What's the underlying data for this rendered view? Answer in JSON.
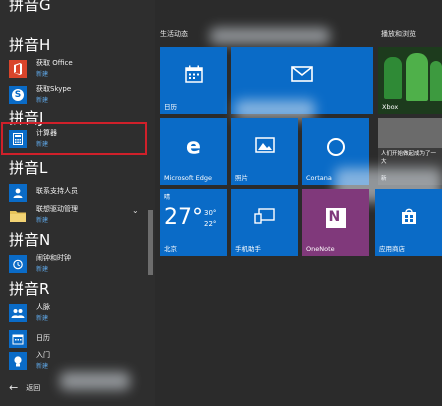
{
  "letters": {
    "h": "拼音H",
    "j": "拼音J",
    "l": "拼音L",
    "n": "拼音N",
    "r": "拼音R",
    "top_partial": "拼音G"
  },
  "apps": [
    {
      "name": "获取 Office",
      "sub": "新建"
    },
    {
      "name": "获取Skype",
      "sub": "新建"
    },
    {
      "name": "计算器",
      "sub": "新建"
    },
    {
      "name": "联系支持人员",
      "sub": ""
    },
    {
      "name": "联想驱动管理",
      "sub": "新建"
    },
    {
      "name": "闹钟和时钟",
      "sub": "新建"
    },
    {
      "name": "人脉",
      "sub": "新建"
    },
    {
      "name": "日历",
      "sub": ""
    },
    {
      "name": "入门",
      "sub": "新建"
    }
  ],
  "back_label": "返回",
  "groups": {
    "life": "生活动态",
    "play": "播放和浏览"
  },
  "tiles": {
    "calendar": "日历",
    "mail": "",
    "edge": "Microsoft Edge",
    "photos": "照片",
    "cortana": "Cortana",
    "weather_label": "北京",
    "weather_condition": "晴",
    "weather_temp": "27°",
    "weather_high": "30°",
    "weather_low": "22°",
    "phone": "手机助手",
    "onenote": "OneNote",
    "store": "应用商店",
    "xbox": "Xbox",
    "news": "人们开始做起成为了一大",
    "news_more": "新"
  },
  "colors": {
    "tile_blue": "#0a6bc7",
    "onenote_purple": "#80397b",
    "selection_red": "#d0202a",
    "subtext_blue": "#5fa8e8"
  }
}
